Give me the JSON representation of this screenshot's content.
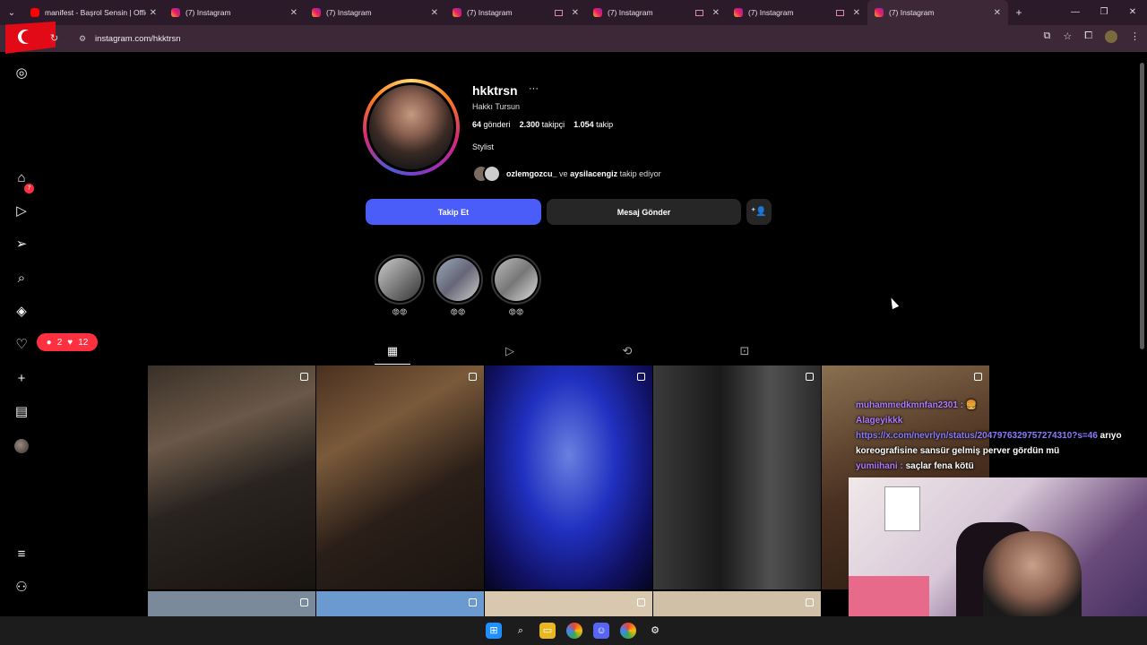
{
  "browser": {
    "tabs": [
      {
        "title": "manifest - Başrol Sensin | Officia",
        "favicon": "youtube-icon",
        "active": false
      },
      {
        "title": "(7) Instagram",
        "favicon": "instagram-icon",
        "active": false
      },
      {
        "title": "(7) Instagram",
        "favicon": "instagram-icon",
        "active": false
      },
      {
        "title": "(7) Instagram",
        "favicon": "instagram-icon",
        "active": false
      },
      {
        "title": "(7) Instagram",
        "favicon": "instagram-icon",
        "active": false
      },
      {
        "title": "(7) Instagram",
        "favicon": "instagram-icon",
        "active": false
      },
      {
        "title": "(7) Instagram",
        "favicon": "instagram-icon",
        "active": true
      }
    ],
    "url": "instagram.com/hkktrsn"
  },
  "sidebar": {
    "notification_badge": "7",
    "activity_comments": "2",
    "activity_likes": "12"
  },
  "profile": {
    "username": "hkktrsn",
    "full_name": "Hakkı Tursun",
    "posts_count": "64",
    "posts_label": "gönderi",
    "followers_count": "2.300",
    "followers_label": "takipçi",
    "following_count": "1.054",
    "following_label": "takip",
    "bio": "Stylist",
    "mutual_user1": "ozlemgozcu_",
    "mutual_mid": "ve",
    "mutual_user2": "aysilacengiz",
    "mutual_tail": "takip ediyor",
    "follow_button": "Takip Et",
    "message_button": "Mesaj Gönder"
  },
  "highlights": [
    {
      "label": "😡😡"
    },
    {
      "label": "😡😡"
    },
    {
      "label": "😡😡"
    }
  ],
  "chat": [
    {
      "user": "muhammedkmnfan2301 :",
      "message": "🍔"
    },
    {
      "user": "Alageyikkk",
      "message": ""
    },
    {
      "user": "",
      "link": "https://x.com/nevrlyn/status/2047976329757274310?s=46",
      "message": "arıyo koreografisine sansür gelmiş perver gördün mü"
    },
    {
      "user": "yumiihani :",
      "message": "saçlar fena kötü"
    }
  ],
  "colors": {
    "follow_button": "#4a5df9",
    "badge": "#ff3040",
    "chat_user": "#b07cff"
  }
}
